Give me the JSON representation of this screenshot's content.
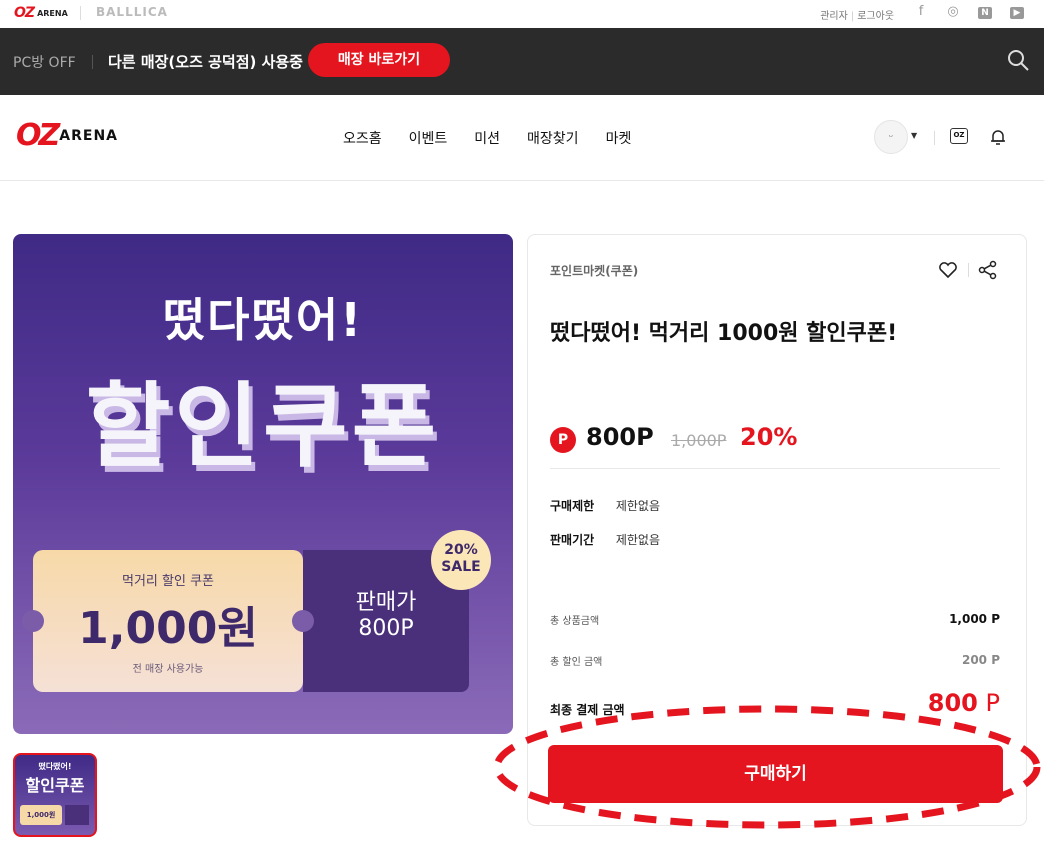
{
  "util": {
    "oz": "OZ",
    "arena": "ARENA",
    "battlica": "BALLLICA",
    "links": [
      "관리자",
      "로그아웃"
    ],
    "social": [
      {
        "name": "facebook-icon",
        "glyph": "f"
      },
      {
        "name": "instagram-icon",
        "glyph": "◎"
      },
      {
        "name": "naver-icon",
        "glyph": "N"
      },
      {
        "name": "youtube-icon",
        "glyph": "▶"
      }
    ]
  },
  "darkbar": {
    "pc_status": "PC방 OFF",
    "store_status": "다른 매장(오즈 공덕점) 사용중",
    "go_button": "매장 바로가기"
  },
  "nav": {
    "brand_oz": "OZ",
    "brand_arena": "ARENA",
    "menu": [
      "오즈홈",
      "이벤트",
      "미션",
      "매장찾기",
      "마켓"
    ],
    "pc_icon": "OZ"
  },
  "hero": {
    "line1": "떴다떴어!",
    "line2": "할인쿠폰",
    "ticket_top": "먹거리 할인 쿠폰",
    "ticket_amount": "1,000원",
    "ticket_bottom": "전 매장 사용가능",
    "side_label": "판매가",
    "side_price": "800P",
    "sale_pct": "20%",
    "sale_word": "SALE"
  },
  "thumb": {
    "line1": "떴다떴어!",
    "line2": "할인쿠폰",
    "amount": "1,000원"
  },
  "product": {
    "category": "포인트마켓(쿠폰)",
    "title": "떴다떴어! 먹거리 1000원 할인쿠폰!",
    "point_badge": "P",
    "price": "800P",
    "original_price": "1,000P",
    "discount": "20%",
    "purchase_limit_label": "구매제한",
    "purchase_limit_value": "제한없음",
    "sale_period_label": "판매기간",
    "sale_period_value": "제한없음",
    "total_label": "총 상품금액",
    "total_value": "1,000 P",
    "discount_label": "총 할인 금액",
    "discount_value": "200 P",
    "final_label": "최종 결제 금액",
    "final_value": "800",
    "final_unit": " P",
    "buy_button": "구매하기"
  },
  "colors": {
    "accent": "#e4151f",
    "dark_bar": "#2b2b2b",
    "hero_purple": "#3f2a86"
  }
}
